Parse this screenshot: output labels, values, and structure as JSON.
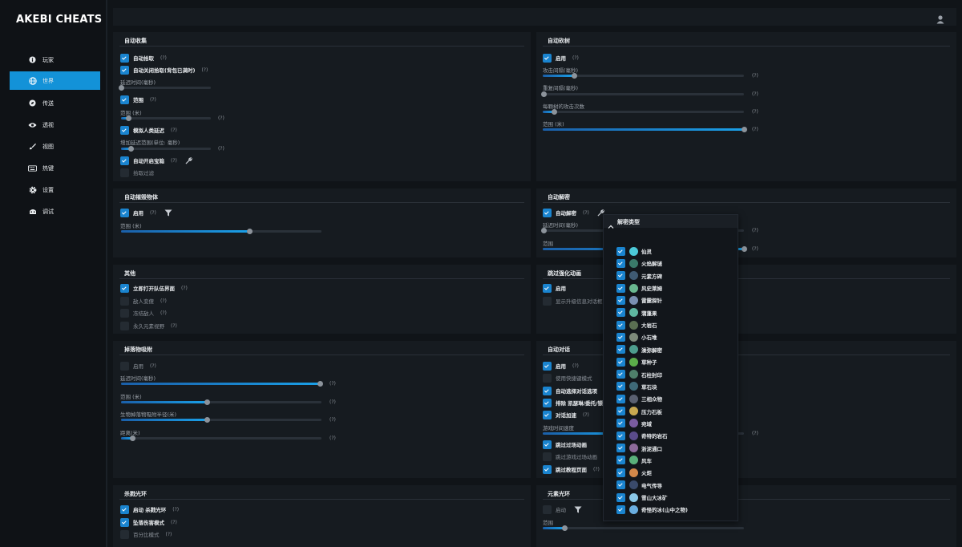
{
  "app": {
    "title": "AKEBI CHEATS"
  },
  "sidebar": {
    "items": [
      {
        "label": "玩家",
        "icon": "info-icon"
      },
      {
        "label": "世界",
        "icon": "globe-icon",
        "active": true
      },
      {
        "label": "传送",
        "icon": "compass-icon"
      },
      {
        "label": "透视",
        "icon": "eye-icon"
      },
      {
        "label": "视图",
        "icon": "brush-icon"
      },
      {
        "label": "热键",
        "icon": "keyboard-icon"
      },
      {
        "label": "设置",
        "icon": "gear-icon"
      },
      {
        "label": "调试",
        "icon": "bug-icon"
      }
    ]
  },
  "panels": {
    "auto_loot": {
      "title": "自动收集",
      "auto_pickup": "自动拾取",
      "auto_pickup_close": "自动关闭拾取(背包已满时)",
      "delay_time": "延迟时间(毫秒)",
      "range_toggle": "范围",
      "range_label": "范围 (米)",
      "human_delay": "模拟人类延迟",
      "delay_range": "增加延迟范围(单位: 毫秒)",
      "auto_chest": "自动开启宝箱",
      "pickup_filter": "拾取过滤",
      "q": "(?)"
    },
    "auto_tree": {
      "title": "自动砍树",
      "enable": "启用",
      "attack_delay": "攻击间隔(毫秒)",
      "repeat_delay": "重复间隔(毫秒)",
      "attacks_per_tree": "每颗树的攻击次数",
      "range": "范围 (米)",
      "q": "(?)"
    },
    "auto_destroy": {
      "title": "自动摧毁物体",
      "enable": "启用",
      "range": "范围 (米)",
      "q": "(?)"
    },
    "auto_puzzle": {
      "title": "自动解密",
      "enable": "自动解密",
      "delay": "延迟时间(毫秒)",
      "range": "范围",
      "q": "(?)"
    },
    "misc": {
      "title": "其他",
      "open_team": "立即打开队伍界面",
      "enemy_change": "敌人变傻",
      "freeze_enemy": "冻结敌人",
      "perm_vision": "永久元素视野",
      "q": "(?)"
    },
    "skip_enhance": {
      "title": "跳过强化动画",
      "enable": "启用",
      "show_upgrade": "显示升级信息对话框"
    },
    "drop_vacuum": {
      "title": "掉落物吸附",
      "enable": "启用",
      "delay": "延迟时间(毫秒)",
      "range": "范围 (米)",
      "mob_radius": "生物掉落物吸附半径(米)",
      "distance": "距离(米)",
      "q": "(?)"
    },
    "auto_talk": {
      "title": "自动对话",
      "enable": "启用",
      "hotkey_mode": "使用快捷键模式",
      "auto_select": "自动选择对话选项",
      "exclude": "排除 凯瑟琳/委托/镖",
      "speedup": "对话加速",
      "game_speed": "游戏时间速度",
      "skip_cutscene": "跳过过场动画",
      "skip_game_cutscene": "跳过游戏过场动画",
      "skip_tutorial": "跳过教程页面",
      "q": "(?)"
    },
    "kill_aura": {
      "title": "杀戮光环",
      "enable": "启动 杀戮光环",
      "fall_damage": "坠落伤害模式",
      "percent": "百分比模式",
      "q": "(?)"
    },
    "element_aura": {
      "title": "元素光环",
      "enable": "启动",
      "range": "范围"
    }
  },
  "popup": {
    "title": "解密类型",
    "items": [
      {
        "label": "仙灵",
        "color": "#4cc9d8"
      },
      {
        "label": "火焰解谜",
        "color": "#3a7a6a"
      },
      {
        "label": "元素方碑",
        "color": "#3f5a72"
      },
      {
        "label": "风史莱姆",
        "color": "#6ab890"
      },
      {
        "label": "雷霆探针",
        "color": "#7a8fb0"
      },
      {
        "label": "蒲蓬果",
        "color": "#5fb7a0"
      },
      {
        "label": "大岩石",
        "color": "#5a6f52"
      },
      {
        "label": "小石堆",
        "color": "#7d8a7a"
      },
      {
        "label": "澡弥解密",
        "color": "#4d9d8d"
      },
      {
        "label": "草种子",
        "color": "#5cae4a"
      },
      {
        "label": "石柱封印",
        "color": "#4e7f6a"
      },
      {
        "label": "草石块",
        "color": "#3f6a78"
      },
      {
        "label": "三相众物",
        "color": "#5a6070"
      },
      {
        "label": "压力石板",
        "color": "#c8a850"
      },
      {
        "label": "宛域",
        "color": "#7a5ca0"
      },
      {
        "label": "奇特的岩石",
        "color": "#5a4c8a"
      },
      {
        "label": "浙泥通口",
        "color": "#8d6a9a"
      },
      {
        "label": "风车",
        "color": "#5ab07a"
      },
      {
        "label": "火炬",
        "color": "#d2884a"
      },
      {
        "label": "电气传导",
        "color": "#3a4a6a"
      },
      {
        "label": "雪山大冰矿",
        "color": "#8ac8e8"
      },
      {
        "label": "奇怪的冰(山中之物)",
        "color": "#6aaee0"
      }
    ]
  }
}
